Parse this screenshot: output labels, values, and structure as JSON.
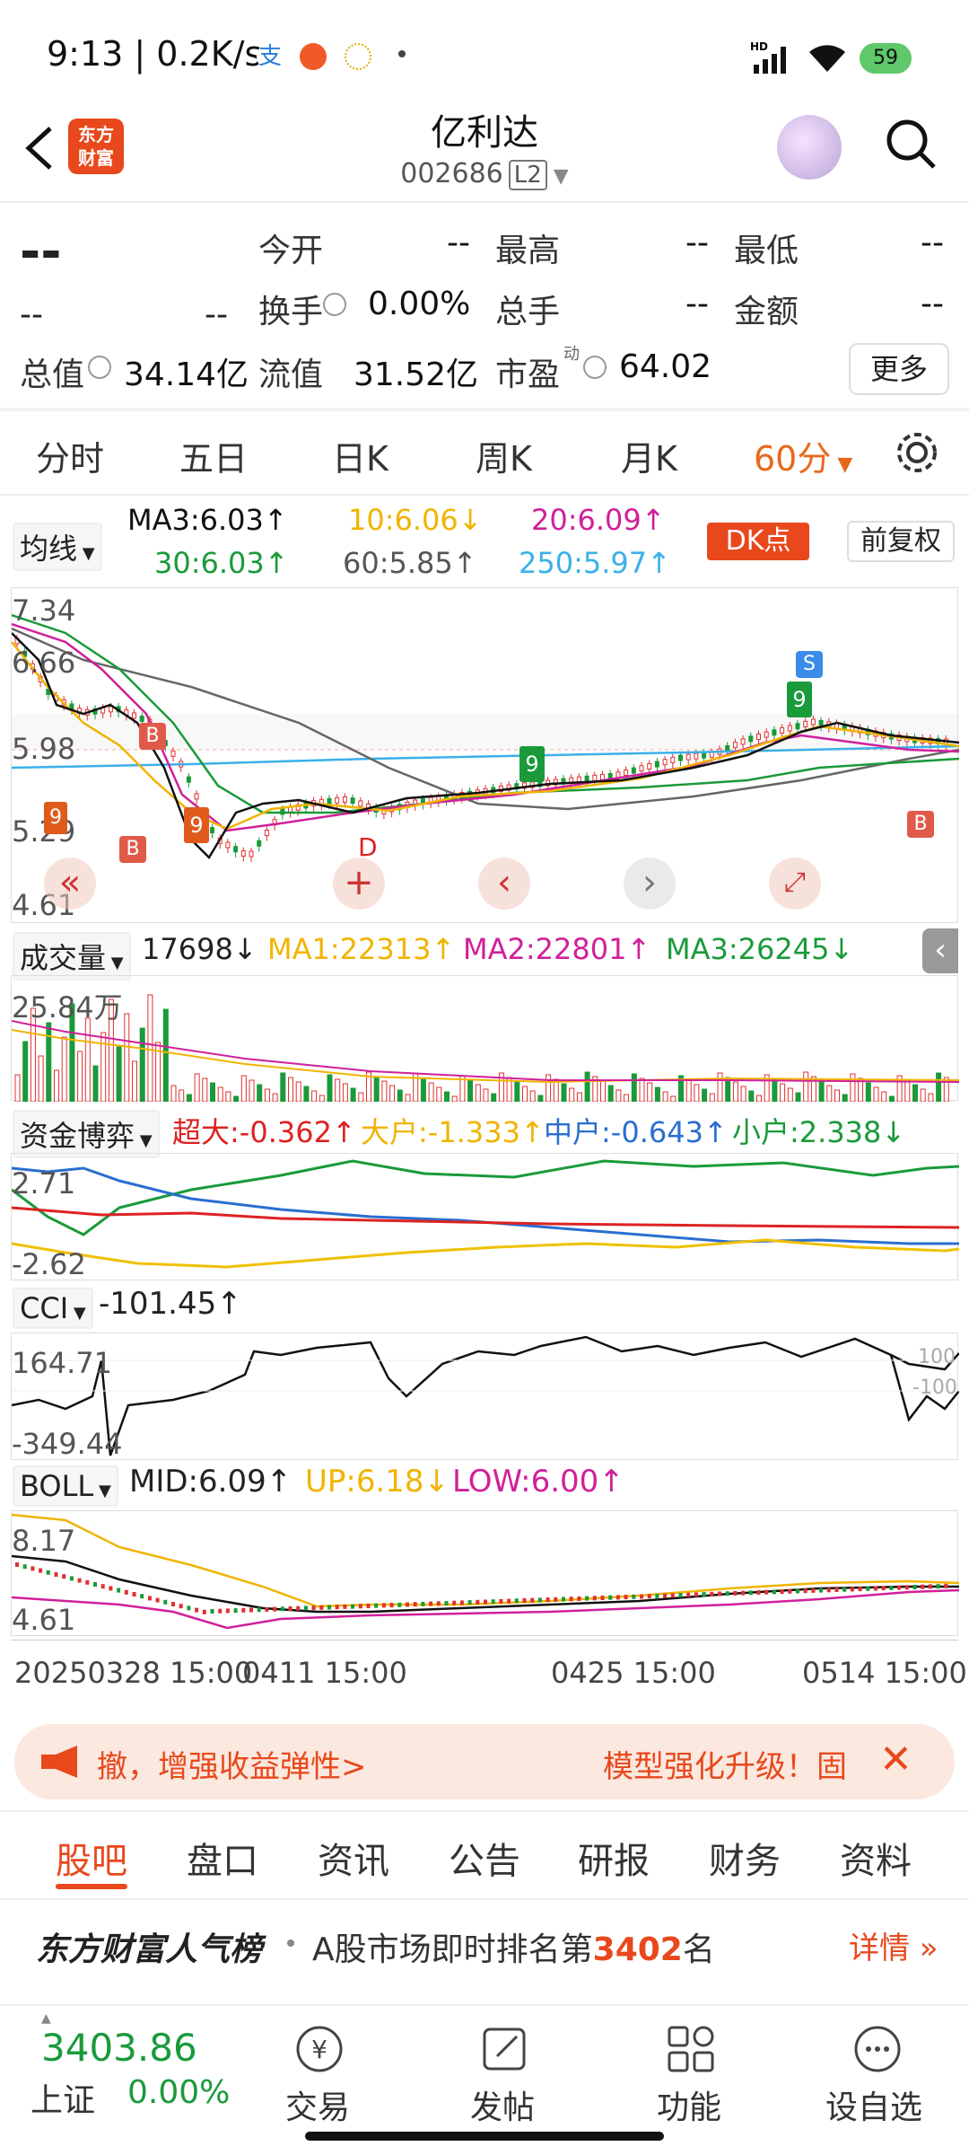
{
  "status_bar": {
    "time_speed": "9:13 | 0.2K/s",
    "battery": "59"
  },
  "header": {
    "logo_text_1": "东方",
    "logo_text_2": "财富",
    "stock_name": "亿利达",
    "stock_code": "002686",
    "level_badge": "L2"
  },
  "quote": {
    "price": "--",
    "change": "--",
    "change_pct": "--",
    "open_label": "今开",
    "open_value": "--",
    "high_label": "最高",
    "high_value": "--",
    "low_label": "最低",
    "low_value": "--",
    "turnover_label": "换手",
    "turnover_value": "0.00%",
    "volume_label": "总手",
    "volume_value": "--",
    "amount_label": "金额",
    "amount_value": "--",
    "mktcap_label": "总值",
    "mktcap_value": "34.14亿",
    "float_label": "流值",
    "float_value": "31.52亿",
    "pe_label": "市盈",
    "pe_sup": "动",
    "pe_value": "64.02",
    "more_button": "更多"
  },
  "chart_tabs": [
    "分时",
    "五日",
    "日K",
    "周K",
    "月K",
    "60分"
  ],
  "ma_row": {
    "selector": "均线",
    "ma3": "MA3:6.03↑",
    "ma10": "10:6.06↓",
    "ma20": "20:6.09↑",
    "ma30": "30:6.03↑",
    "ma60": "60:5.85↑",
    "ma250": "250:5.97↑",
    "dk_button": "DK点",
    "fq_button": "前复权"
  },
  "kline_panel": {
    "y_labels": [
      "7.34",
      "6.66",
      "5.98",
      "5.29",
      "4.61"
    ],
    "markers": [
      "B",
      "B",
      "B",
      "S",
      "9",
      "9",
      "9",
      "9",
      "D"
    ],
    "colors": {
      "up": "#e03030",
      "down": "#1a9a3a",
      "ma3": "#111111",
      "ma10": "#f0b400",
      "ma20": "#d0209a",
      "ma30": "#1a9a3a",
      "ma60": "#666666",
      "ma250": "#3ab0e8"
    }
  },
  "volume_row": {
    "selector": "成交量",
    "value": "17698↓",
    "ma1": "MA1:22313↑",
    "ma2": "MA2:22801↑",
    "ma3": "MA3:26245↓",
    "y_label": "25.84万"
  },
  "fund_row": {
    "selector": "资金博弈",
    "super": "超大:-0.362↑",
    "large": "大户:-1.333↑",
    "mid": "中户:-0.643↑",
    "small": "小户:2.338↓",
    "y_top": "2.71",
    "y_bottom": "-2.62"
  },
  "cci_row": {
    "selector": "CCI",
    "value": "-101.45↑",
    "y_top": "164.71",
    "y_bottom": "-349.44",
    "ref_100": "100",
    "ref_m100": "-100"
  },
  "boll_row": {
    "selector": "BOLL",
    "mid": "MID:6.09↑",
    "up": "UP:6.18↓",
    "low": "LOW:6.00↑",
    "y_top": "8.17",
    "y_bottom": "4.61"
  },
  "time_axis": [
    "20250328 15:00",
    "0411 15:00",
    "0425 15:00",
    "0514 15:00"
  ],
  "banner": {
    "left_text": "撤，增强收益弹性>",
    "right_text": "模型强化升级！固"
  },
  "bottom_tabs": [
    "股吧",
    "盘口",
    "资讯",
    "公告",
    "研报",
    "财务",
    "资料"
  ],
  "rank": {
    "title": "东方财富人气榜",
    "text_prefix": "A股市场即时排名第",
    "rank_number": "3402",
    "text_suffix": "名",
    "details": "详情"
  },
  "bottom_nav": {
    "index_value": "3403.86",
    "index_name": "上证",
    "index_change": "0.00%",
    "items": [
      "交易",
      "发帖",
      "功能",
      "设自选"
    ]
  }
}
